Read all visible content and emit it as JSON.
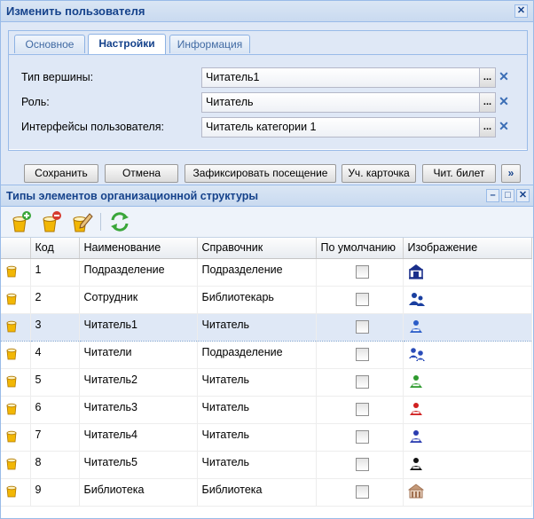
{
  "dialog": {
    "title": "Изменить пользователя",
    "close_glyph": "✕",
    "tabs": [
      {
        "label": "Основное"
      },
      {
        "label": "Настройки"
      },
      {
        "label": "Информация"
      }
    ],
    "fields": [
      {
        "label": "Тип вершины:",
        "value": "Читатель1"
      },
      {
        "label": "Роль:",
        "value": "Читатель"
      },
      {
        "label": "Интерфейсы пользователя:",
        "value": "Читатель категории 1"
      }
    ],
    "dots_glyph": "...",
    "clear_glyph": "✕",
    "buttons": [
      {
        "label": "Сохранить"
      },
      {
        "label": "Отмена"
      },
      {
        "label": "Зафиксировать посещение"
      },
      {
        "label": "Уч. карточка"
      },
      {
        "label": "Чит. билет"
      }
    ],
    "more_glyph": "»"
  },
  "panel": {
    "title": "Типы элементов организационной структуры",
    "minimize_glyph": "–",
    "maximize_glyph": "□",
    "close_glyph": "✕",
    "toolbar_icons": [
      "add-icon",
      "delete-icon",
      "edit-icon",
      "refresh-icon"
    ],
    "columns": [
      "Код",
      "Наименование",
      "Справочник",
      "По умолчанию",
      "Изображение"
    ],
    "rows": [
      {
        "code": "1",
        "name": "Подразделение",
        "ref": "Подразделение",
        "icon": "building-icon",
        "color": "#1a2f8a"
      },
      {
        "code": "2",
        "name": "Сотрудник",
        "ref": "Библиотекарь",
        "icon": "staff-icon",
        "color": "#1a3fa0"
      },
      {
        "code": "3",
        "name": "Читатель1",
        "ref": "Читатель",
        "icon": "reader-icon",
        "color": "#2a5cc8"
      },
      {
        "code": "4",
        "name": "Читатели",
        "ref": "Подразделение",
        "icon": "readers-group-icon",
        "color": "#2a4cb8"
      },
      {
        "code": "5",
        "name": "Читатель2",
        "ref": "Читатель",
        "icon": "reader-icon",
        "color": "#2e9a2e"
      },
      {
        "code": "6",
        "name": "Читатель3",
        "ref": "Читатель",
        "icon": "reader-icon",
        "color": "#d02020"
      },
      {
        "code": "7",
        "name": "Читатель4",
        "ref": "Читатель",
        "icon": "reader-icon",
        "color": "#2a3cb0"
      },
      {
        "code": "8",
        "name": "Читатель5",
        "ref": "Читатель",
        "icon": "reader-icon",
        "color": "#111111"
      },
      {
        "code": "9",
        "name": "Библиотека",
        "ref": "Библиотека",
        "icon": "library-icon",
        "color": "#a07050"
      }
    ]
  }
}
